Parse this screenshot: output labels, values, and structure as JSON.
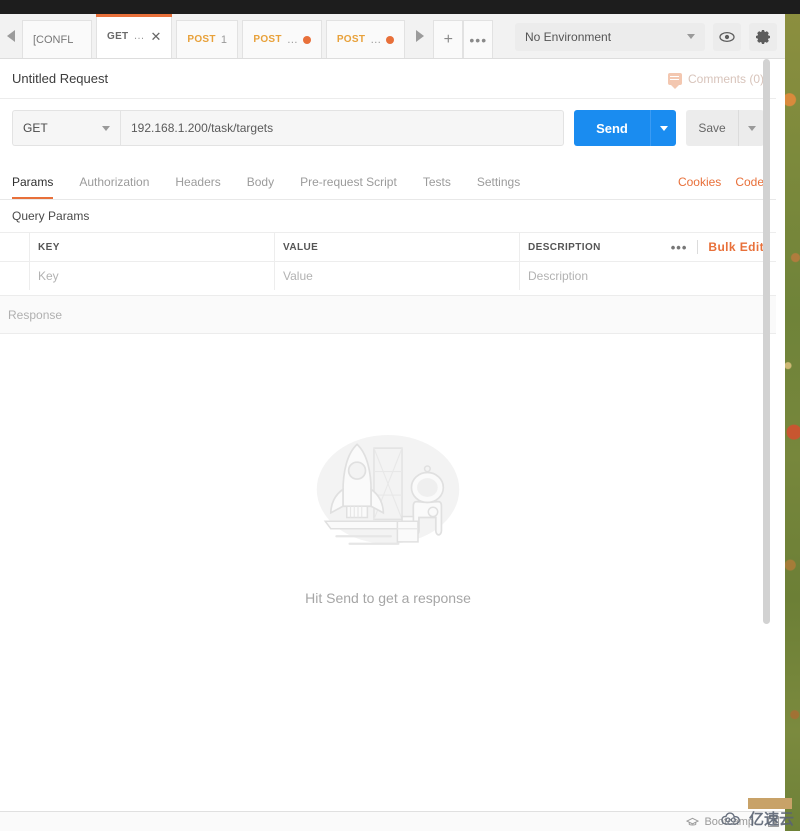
{
  "tabbar": {
    "scroll_left_icon": "arrow-left-icon",
    "scroll_right_icon": "arrow-right-icon",
    "new_tab_label": "+",
    "more_label": "•••",
    "tabs": [
      {
        "label": "[CONFL",
        "verb": "",
        "active": false,
        "dirty": false
      },
      {
        "label": "…",
        "verb": "GET",
        "active": true,
        "dirty": false,
        "close": "✕"
      },
      {
        "label": "1",
        "verb": "POST",
        "active": false,
        "dirty": false
      },
      {
        "label": "…",
        "verb": "POST",
        "active": false,
        "dirty": true
      },
      {
        "label": "…",
        "verb": "POST",
        "active": false,
        "dirty": true
      }
    ]
  },
  "environment": {
    "selected": "No Environment",
    "eye_icon": "eye-icon",
    "settings_icon": "gear-icon"
  },
  "request": {
    "title": "Untitled Request",
    "comments_label": "Comments (0)",
    "method": "GET",
    "url": "192.168.1.200/task/targets",
    "send_label": "Send",
    "save_label": "Save"
  },
  "subtabs": {
    "items": [
      {
        "label": "Params",
        "active": true
      },
      {
        "label": "Authorization",
        "active": false
      },
      {
        "label": "Headers",
        "active": false
      },
      {
        "label": "Body",
        "active": false
      },
      {
        "label": "Pre-request Script",
        "active": false
      },
      {
        "label": "Tests",
        "active": false
      },
      {
        "label": "Settings",
        "active": false
      }
    ],
    "cookies_label": "Cookies",
    "code_label": "Code"
  },
  "params": {
    "section_label": "Query Params",
    "columns": [
      "KEY",
      "VALUE",
      "DESCRIPTION"
    ],
    "rows": [
      {
        "key": "Key",
        "value": "Value",
        "description": "Description"
      }
    ],
    "more_label": "•••",
    "bulk_edit_label": "Bulk Edit"
  },
  "response": {
    "label": "Response",
    "empty_message": "Hit Send to get a response",
    "illustration": "rocket-astronaut-illustration"
  },
  "statusbar": {
    "bootcamp_label": "Bootcamp",
    "bootcamp_icon": "graduation-cap-icon",
    "panel_icon": "layout-panel-icon"
  },
  "watermark": {
    "text": "亿速云",
    "icon": "cloud-logo-icon"
  },
  "colors": {
    "accent_orange": "#e8703a",
    "send_blue": "#1a8cf0",
    "post_amber": "#e8a13a"
  }
}
